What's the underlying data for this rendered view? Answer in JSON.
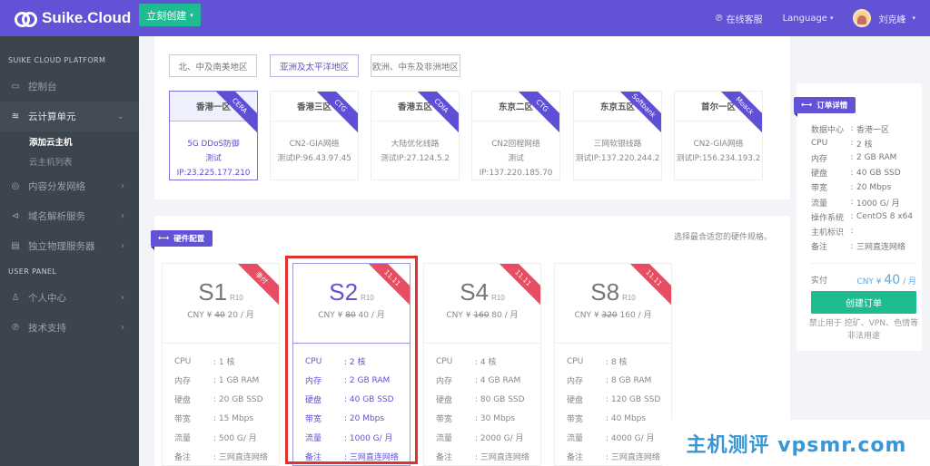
{
  "topbar": {
    "brand": "Suike.Cloud",
    "create_label": "立刻创建",
    "support_label": "在线客服",
    "language_label": "Language",
    "user_name": "刘克峰"
  },
  "sidebar": {
    "platform_title": "SUIKE CLOUD PLATFORM",
    "items": [
      {
        "label": "控制台",
        "icon": "monitor-icon"
      },
      {
        "label": "云计算单元",
        "icon": "layers-icon",
        "active": true,
        "expanded": true
      },
      {
        "label": "内容分发网络",
        "icon": "cdn-icon"
      },
      {
        "label": "域名解析服务",
        "icon": "dns-icon"
      },
      {
        "label": "独立物理服务器",
        "icon": "server-icon"
      }
    ],
    "subitems": [
      {
        "label": "添加云主机",
        "active": true
      },
      {
        "label": "云主机列表"
      }
    ],
    "user_panel_title": "USER PANEL",
    "user_items": [
      {
        "label": "个人中心",
        "icon": "user-icon"
      },
      {
        "label": "技术支持",
        "icon": "support-icon"
      }
    ]
  },
  "regions": [
    {
      "label": "北、中及南美地区"
    },
    {
      "label": "亚洲及太平洋地区",
      "selected": true
    },
    {
      "label": "欧洲、中东及非洲地区"
    }
  ],
  "datacenters": [
    {
      "name": "香港一区",
      "ribbon": "CERA",
      "feature": "5G DDoS防御",
      "test_ip": "测试IP:23.225.177.210",
      "selected": true
    },
    {
      "name": "香港三区",
      "ribbon": "CTG",
      "feature": "CN2-GIA网络",
      "test_ip": "测试IP:96.43.97.45"
    },
    {
      "name": "香港五区",
      "ribbon": "CDIA",
      "feature": "大陆优化线路",
      "test_ip": "测试IP:27.124.5.2"
    },
    {
      "name": "东京二区",
      "ribbon": "CTG",
      "feature": "CN2回程网络",
      "test_ip": "测试IP:137.220.185.70"
    },
    {
      "name": "东京五区",
      "ribbon": "Softbank",
      "feature": "三网软银线路",
      "test_ip": "测试IP:137.220.244.2"
    },
    {
      "name": "首尔一区",
      "ribbon": "Moack",
      "feature": "CN2-GIA网络",
      "test_ip": "测试IP:156.234.193.2"
    }
  ],
  "hardware": {
    "tag": "硬件配置",
    "hint": "选择最合适您的硬件规格。",
    "spec_labels": {
      "cpu": "CPU",
      "ram": "内存",
      "disk": "硬盘",
      "bw": "带宽",
      "traffic": "流量",
      "note": "备注"
    },
    "plans": [
      {
        "name": "S1",
        "sub": "R10",
        "ribbon": "季付",
        "currency": "CNY ¥",
        "old_price": "40",
        "price": "20 / 月",
        "cpu": ": 1 核",
        "ram": ": 1 GB RAM",
        "disk": ": 20 GB SSD",
        "bw": ": 15 Mbps",
        "traffic": ": 500 G/ 月",
        "note": ": 三网直连网络"
      },
      {
        "name": "S2",
        "sub": "R10",
        "ribbon": "11.11",
        "currency": "CNY ¥",
        "old_price": "80",
        "price": "40 / 月",
        "cpu": ": 2 核",
        "ram": ": 2 GB RAM",
        "disk": ": 40 GB SSD",
        "bw": ": 20 Mbps",
        "traffic": ": 1000 G/ 月",
        "note": ": 三网直连网络",
        "selected": true
      },
      {
        "name": "S4",
        "sub": "R10",
        "ribbon": "11.11",
        "currency": "CNY ¥",
        "old_price": "160",
        "price": "80 / 月",
        "cpu": ": 4 核",
        "ram": ": 4 GB RAM",
        "disk": ": 80 GB SSD",
        "bw": ": 30 Mbps",
        "traffic": ": 2000 G/ 月",
        "note": ": 三网直连网络"
      },
      {
        "name": "S8",
        "sub": "R10",
        "ribbon": "11.11",
        "currency": "CNY ¥",
        "old_price": "320",
        "price": "160 / 月",
        "cpu": ": 8 核",
        "ram": ": 8 GB RAM",
        "disk": ": 120 GB SSD",
        "bw": ": 40 Mbps",
        "traffic": ": 4000 G/ 月",
        "note": ": 三网直连网络"
      }
    ]
  },
  "order": {
    "tag": "订单详情",
    "rows": [
      {
        "k": "数据中心",
        "v": "香港一区"
      },
      {
        "k": "CPU",
        "v": "2 核"
      },
      {
        "k": "内存",
        "v": "2 GB RAM"
      },
      {
        "k": "硬盘",
        "v": "40 GB SSD"
      },
      {
        "k": "带宽",
        "v": "20 Mbps"
      },
      {
        "k": "流量",
        "v": " 1000 G/ 月"
      },
      {
        "k": "操作系统",
        "v": "CentOS 8 x64"
      },
      {
        "k": "主机标识",
        "v": ""
      },
      {
        "k": "备注",
        "v": "三网直连网络"
      }
    ],
    "pay_label": "实付",
    "pay_currency": "CNY ¥",
    "pay_amount": "40",
    "pay_unit": "/ 月",
    "button_label": "创建订单",
    "note": "禁止用于 挖矿、VPN、色情等非法用途"
  },
  "watermark": {
    "text": "主机测评 vpsmr.com"
  }
}
